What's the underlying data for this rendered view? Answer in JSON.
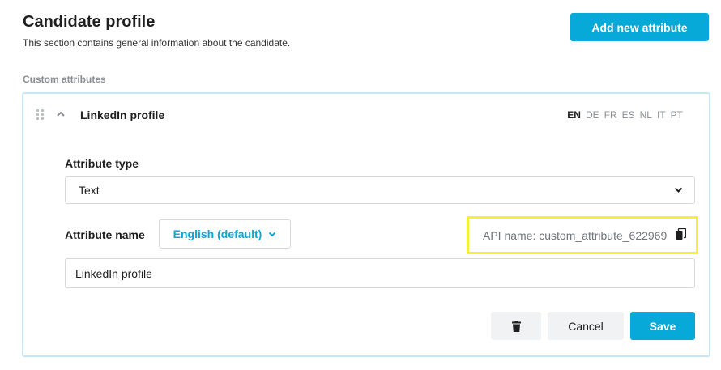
{
  "header": {
    "title": "Candidate profile",
    "subtitle": "This section contains general information about the candidate.",
    "add_button_label": "Add new attribute"
  },
  "section": {
    "label": "Custom attributes"
  },
  "attribute_card": {
    "title": "LinkedIn profile",
    "languages": [
      "EN",
      "DE",
      "FR",
      "ES",
      "NL",
      "IT",
      "PT"
    ],
    "active_language": "EN",
    "type_label": "Attribute type",
    "type_value": "Text",
    "name_label": "Attribute name",
    "name_language": "English (default)",
    "api_name": "API name: custom_attribute_622969",
    "name_value": "LinkedIn profile",
    "cancel_label": "Cancel",
    "save_label": "Save"
  },
  "icons": {
    "drag": "drag-handle-icon",
    "collapse": "chevron-up-icon",
    "dropdown": "chevron-down-icon",
    "copy": "copy-icon",
    "delete": "trash-icon"
  },
  "colors": {
    "accent": "#06a9d8",
    "card_border": "#c5e8f4",
    "highlight": "#f4f037"
  }
}
